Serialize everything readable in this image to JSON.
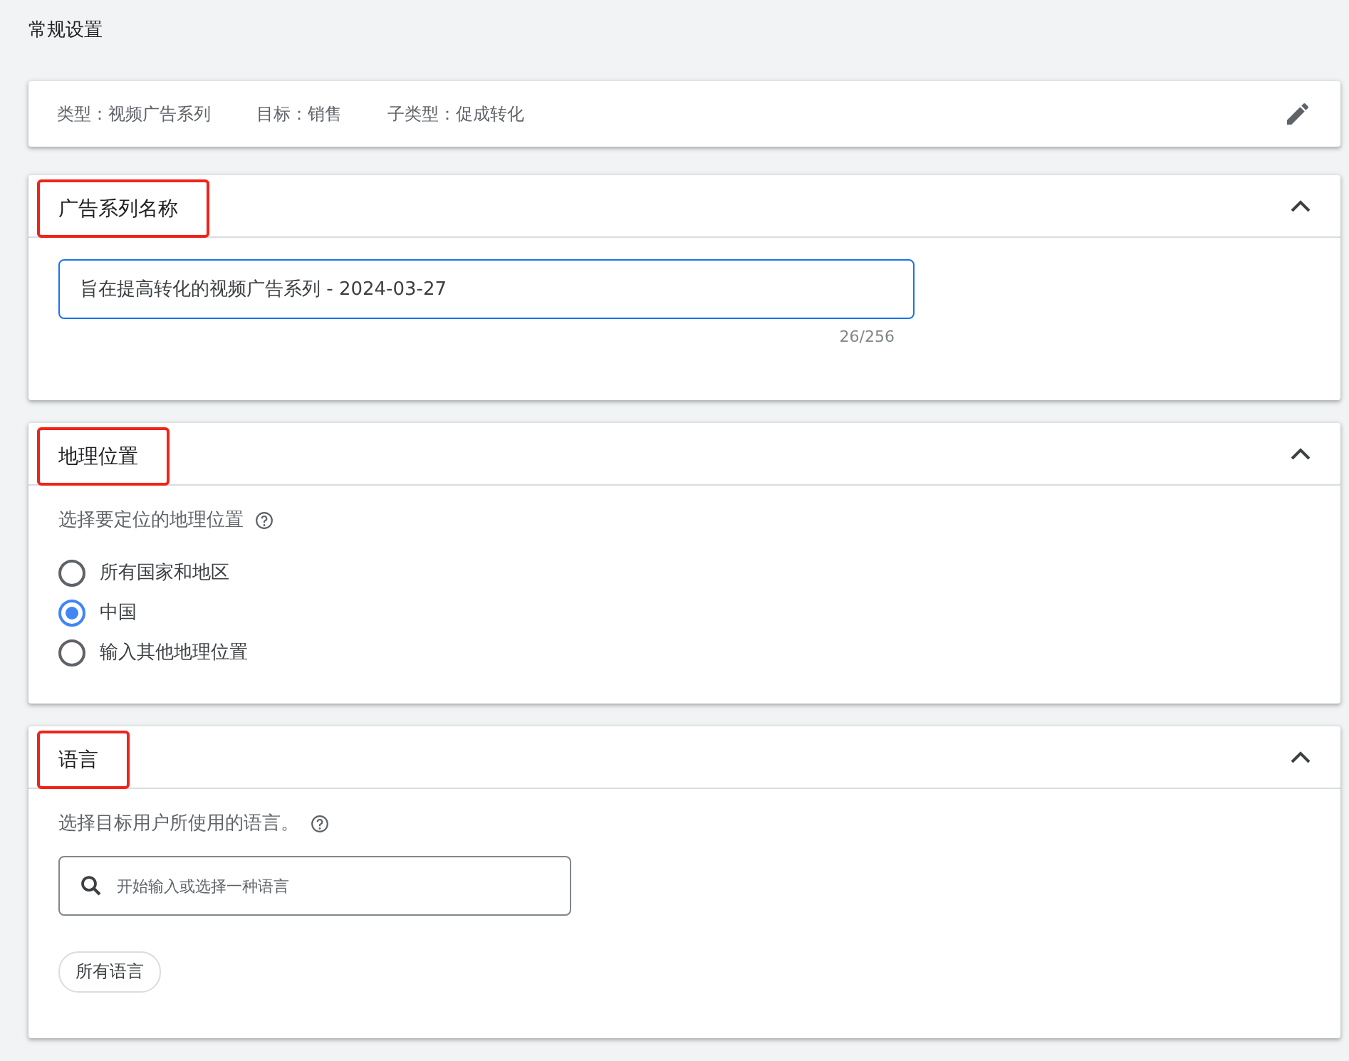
{
  "page_title": "常规设置",
  "summary": {
    "items": [
      "类型：视频广告系列",
      "目标：销售",
      "子类型：促成转化"
    ]
  },
  "sections": [
    {
      "kind": "name",
      "title": "广告系列名称",
      "highlighted": true,
      "expanded": true,
      "value": "旨在提高转化的视频广告系列 - 2024-03-27",
      "counter": "26/256"
    },
    {
      "kind": "location",
      "title": "地理位置",
      "highlighted": true,
      "expanded": true,
      "prompt": "选择要定位的地理位置",
      "options": [
        {
          "label": "所有国家和地区",
          "selected": false
        },
        {
          "label": "中国",
          "selected": true
        },
        {
          "label": "输入其他地理位置",
          "selected": false
        }
      ]
    },
    {
      "kind": "language",
      "title": "语言",
      "highlighted": true,
      "expanded": true,
      "prompt": "选择目标用户所使用的语言。",
      "search": {
        "placeholder": "开始输入或选择一种语言"
      },
      "chips": [
        "所有语言"
      ]
    }
  ]
}
